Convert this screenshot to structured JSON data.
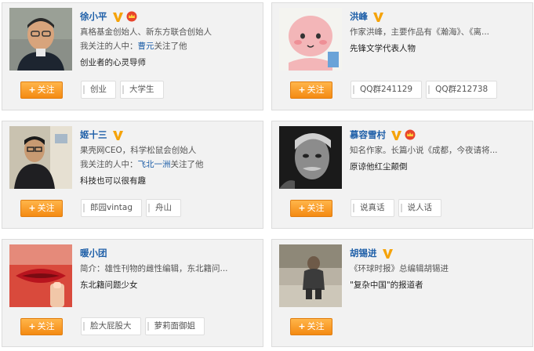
{
  "follow_label": "关注",
  "follow_plus": "+",
  "colors": {
    "name": "#1e5fa8",
    "follow_button": "#f7941d",
    "v_badge": "#f5a30a"
  },
  "cards": [
    {
      "name": "徐小平",
      "crown": true,
      "line1": "真格基金创始人、新东方联合创始人",
      "line2_prefix": "我关注的人中：",
      "line2_link": "曹元",
      "line2_suffix": "关注了他",
      "motto": "创业者的心灵导师",
      "tags": [
        "创业",
        "大学生"
      ]
    },
    {
      "name": "洪峰",
      "crown": false,
      "line1": "作家洪峰，主要作品有《瀚海》、《离...",
      "motto": "先锋文学代表人物",
      "tags": [
        "QQ群241129",
        "QQ群212738"
      ]
    },
    {
      "name": "姬十三",
      "crown": false,
      "line1": "果壳网CEO，科学松鼠会创始人",
      "line2_prefix": "我关注的人中：",
      "line2_link": "飞北一洲",
      "line2_suffix": "关注了他",
      "motto": "科技也可以很有趣",
      "tags": [
        "郎园vintag",
        "舟山"
      ]
    },
    {
      "name": "慕容雪村",
      "crown": true,
      "line1": "知名作家。长篇小说《成都，今夜请将...",
      "motto": "原谅他红尘颠倒",
      "tags": [
        "说真话",
        "说人话"
      ]
    },
    {
      "name": "暖小团",
      "crown": false,
      "line1": "简介：雄性刊物的雌性编辑，东北籍问...",
      "motto": "东北籍问题少女",
      "tags": [
        "脸大屁股大",
        "萝莉面御姐"
      ]
    },
    {
      "name": "胡锡进",
      "crown": false,
      "line1": "《环球时报》总编辑胡锡进",
      "motto": "\"复杂中国\"的报道者",
      "tags": []
    }
  ]
}
